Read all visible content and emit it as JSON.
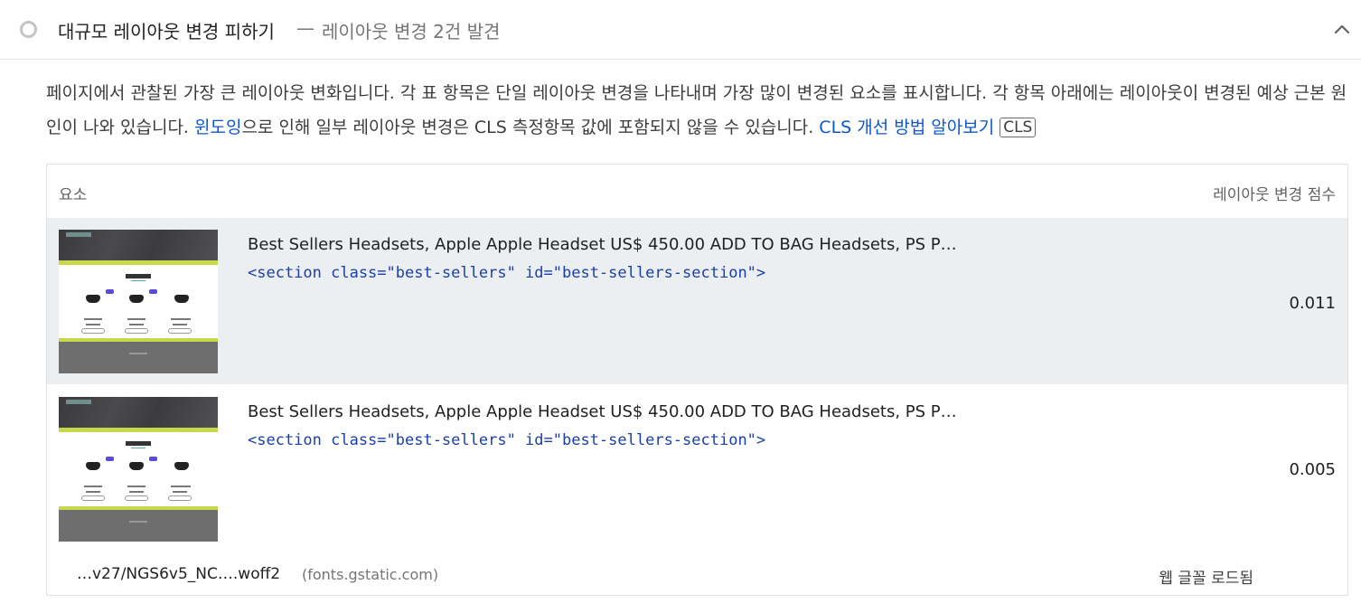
{
  "audit": {
    "title": "대규모 레이아웃 변경 피하기",
    "separator": "—",
    "display_value": "레이아웃 변경 2건 발견",
    "status_icon": "neutral-circle-icon",
    "expand_icon": "chevron-up-icon"
  },
  "description": {
    "part1": "페이지에서 관찰된 가장 큰 레이아웃 변화입니다. 각 표 항목은 단일 레이아웃 변경을 나타내며 가장 많이 변경된 요소를 표시합니다. 각 항목 아래에는 레이아웃이 변경된 예상 근본 원인이 나와 있습니다. ",
    "link_windowing": "윈도잉",
    "part2": "으로 인해 일부 레이아웃 변경은 CLS 측정항목 값에 포함되지 않을 수 있습니다. ",
    "link_learn_more": "CLS 개선 방법 알아보기",
    "badge": "CLS",
    "link_color": "#0b57d0"
  },
  "table": {
    "headers": {
      "element": "요소",
      "score": "레이아웃 변경 점수"
    },
    "rows": [
      {
        "node_label": "Best Sellers Headsets, Apple Apple Headset US$ 450.00 ADD TO BAG Headsets, PS P…",
        "snippet": "<section class=\"best-sellers\" id=\"best-sellers-section\">",
        "score": "0.011"
      },
      {
        "node_label": "Best Sellers Headsets, Apple Apple Headset US$ 450.00 ADD TO BAG Headsets, PS P…",
        "snippet": "<section class=\"best-sellers\" id=\"best-sellers-section\">",
        "score": "0.005"
      }
    ],
    "subitem": {
      "url": "…v27/NGS6v5_NC….woff2",
      "host": "(fonts.gstatic.com)",
      "reason": "웹 글꼴 로드됨"
    }
  }
}
